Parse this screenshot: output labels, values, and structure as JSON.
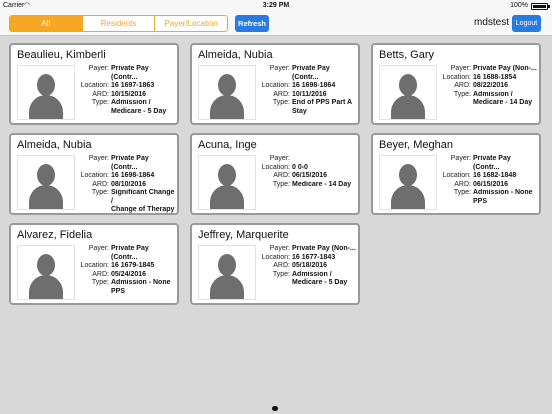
{
  "status": {
    "carrier": "Carrier",
    "time": "3:29 PM",
    "battery": "100%",
    "wifi_icon": "wifi-icon"
  },
  "nav": {
    "segments": [
      "All",
      "Residents",
      "Payer/Location"
    ],
    "active_segment": "All",
    "refresh_label": "Refresh",
    "user": "mdstest",
    "logout_label": "Logout",
    "accent_color": "#f5a623",
    "button_color": "#2a7be0"
  },
  "labels": {
    "payer": "Payer:",
    "location": "Location:",
    "ard": "ARD:",
    "type": "Type:"
  },
  "cards": [
    {
      "name": "Beaulieu, Kimberli",
      "payer": "Private Pay (Contr...",
      "location": "16 1697-1863",
      "ard": "10/15/2016",
      "type": "Admission /\nMedicare - 5 Day"
    },
    {
      "name": "Almeida, Nubia",
      "payer": "Private Pay (Contr...",
      "location": "16 1698-1864",
      "ard": "10/11/2016",
      "type": "End of PPS Part A\nStay"
    },
    {
      "name": "Betts, Gary",
      "payer": "Private Pay (Non-...",
      "location": "16 1688-1854",
      "ard": "08/22/2016",
      "type": "Admission /\nMedicare - 14 Day"
    },
    {
      "name": "Almeida, Nubia",
      "payer": "Private Pay (Contr...",
      "location": "16 1698-1864",
      "ard": "08/10/2016",
      "type": "Significant Change /\nChange of Therapy"
    },
    {
      "name": "Acuna, Inge",
      "payer": "",
      "location": "0 0-0",
      "ard": "06/15/2016",
      "type": "Medicare - 14 Day"
    },
    {
      "name": "Beyer, Meghan",
      "payer": "Private Pay (Contr...",
      "location": "16 1682-1848",
      "ard": "06/15/2016",
      "type": "Admission - None\nPPS"
    },
    {
      "name": "Alvarez, Fidelia",
      "payer": "Private Pay (Contr...",
      "location": "16 1679-1845",
      "ard": "05/24/2016",
      "type": "Admission - None\nPPS"
    },
    {
      "name": "Jeffrey, Marquerite",
      "payer": "Private Pay (Non-...",
      "location": "16 1677-1843",
      "ard": "05/18/2016",
      "type": "Admission /\nMedicare - 5 Day"
    }
  ]
}
